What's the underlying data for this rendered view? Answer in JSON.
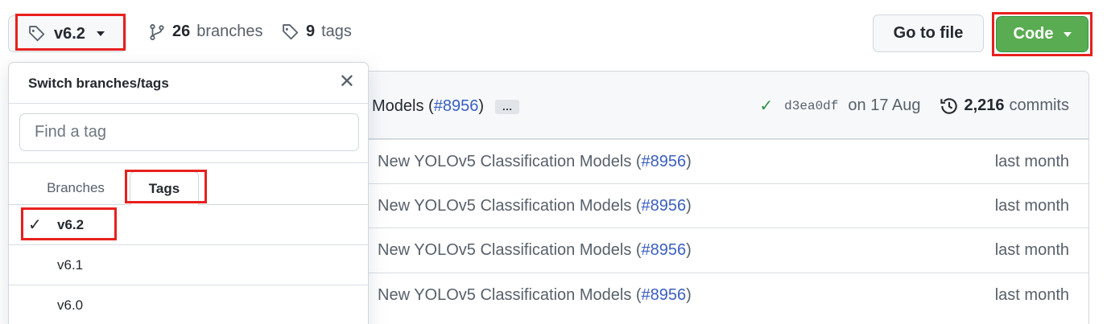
{
  "toolbar": {
    "current_ref": "v6.2",
    "branches_count": "26",
    "branches_label": "branches",
    "tags_count": "9",
    "tags_label": "tags",
    "goto_file_label": "Go to file",
    "code_label": "Code"
  },
  "latest_commit": {
    "message_prefix": "Models (",
    "pr_link": "#8956",
    "message_suffix": ")",
    "ellipsis": "…",
    "sha": "d3ea0df",
    "date": "on 17 Aug",
    "commits_count": "2,216",
    "commits_label": "commits",
    "status_color": "#2f8f47"
  },
  "files": [
    {
      "msg_text": "New YOLOv5 Classification Models (",
      "pr": "#8956",
      "close": ")",
      "age": "last month"
    },
    {
      "msg_text": "New YOLOv5 Classification Models (",
      "pr": "#8956",
      "close": ")",
      "age": "last month"
    },
    {
      "msg_text": "New YOLOv5 Classification Models (",
      "pr": "#8956",
      "close": ")",
      "age": "last month"
    },
    {
      "msg_text": "New YOLOv5 Classification Models (",
      "pr": "#8956",
      "close": ")",
      "age": "last month"
    }
  ],
  "dropdown": {
    "title": "Switch branches/tags",
    "close_icon": "close-icon",
    "filter_placeholder": "Find a tag",
    "tabs": [
      {
        "label": "Branches",
        "active": false
      },
      {
        "label": "Tags",
        "active": true
      }
    ],
    "items": [
      {
        "label": "v6.2",
        "selected": true
      },
      {
        "label": "v6.1",
        "selected": false
      },
      {
        "label": "v6.0",
        "selected": false
      }
    ]
  },
  "colors": {
    "accent_green": "#5aac52",
    "highlight_red": "#e8201d",
    "link_blue": "#3b5fc0"
  }
}
